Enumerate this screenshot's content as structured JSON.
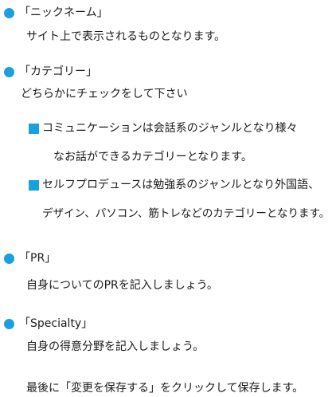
{
  "sections": [
    {
      "heading": "「ニックネーム」",
      "lines": [
        "サイト上で表示されるものとなります。"
      ]
    },
    {
      "heading": "「カテゴリー」",
      "lines": [
        "どちらかにチェックをして下さい"
      ],
      "items": [
        {
          "lines": [
            "コミュニケーションは会話系のジャンルとなり様々",
            "なお話ができるカテゴリーとなります。"
          ]
        },
        {
          "lines": [
            "セルフプロデュースは勉強系のジャンルとなり外国語、",
            "デザイン、パソコン、筋トレなどのカテゴリーとなります。"
          ]
        }
      ]
    },
    {
      "heading": "「PR」",
      "lines": [
        "自身についてのPRを記入しましょう。"
      ]
    },
    {
      "heading": "「Specialty」",
      "lines": [
        "自身の得意分野を記入しましょう。"
      ]
    }
  ],
  "footer": "最後に「変更を保存する」をクリックして保存します。",
  "colors": {
    "accent": "#1aa0e0",
    "text": "#1a1a1a"
  }
}
